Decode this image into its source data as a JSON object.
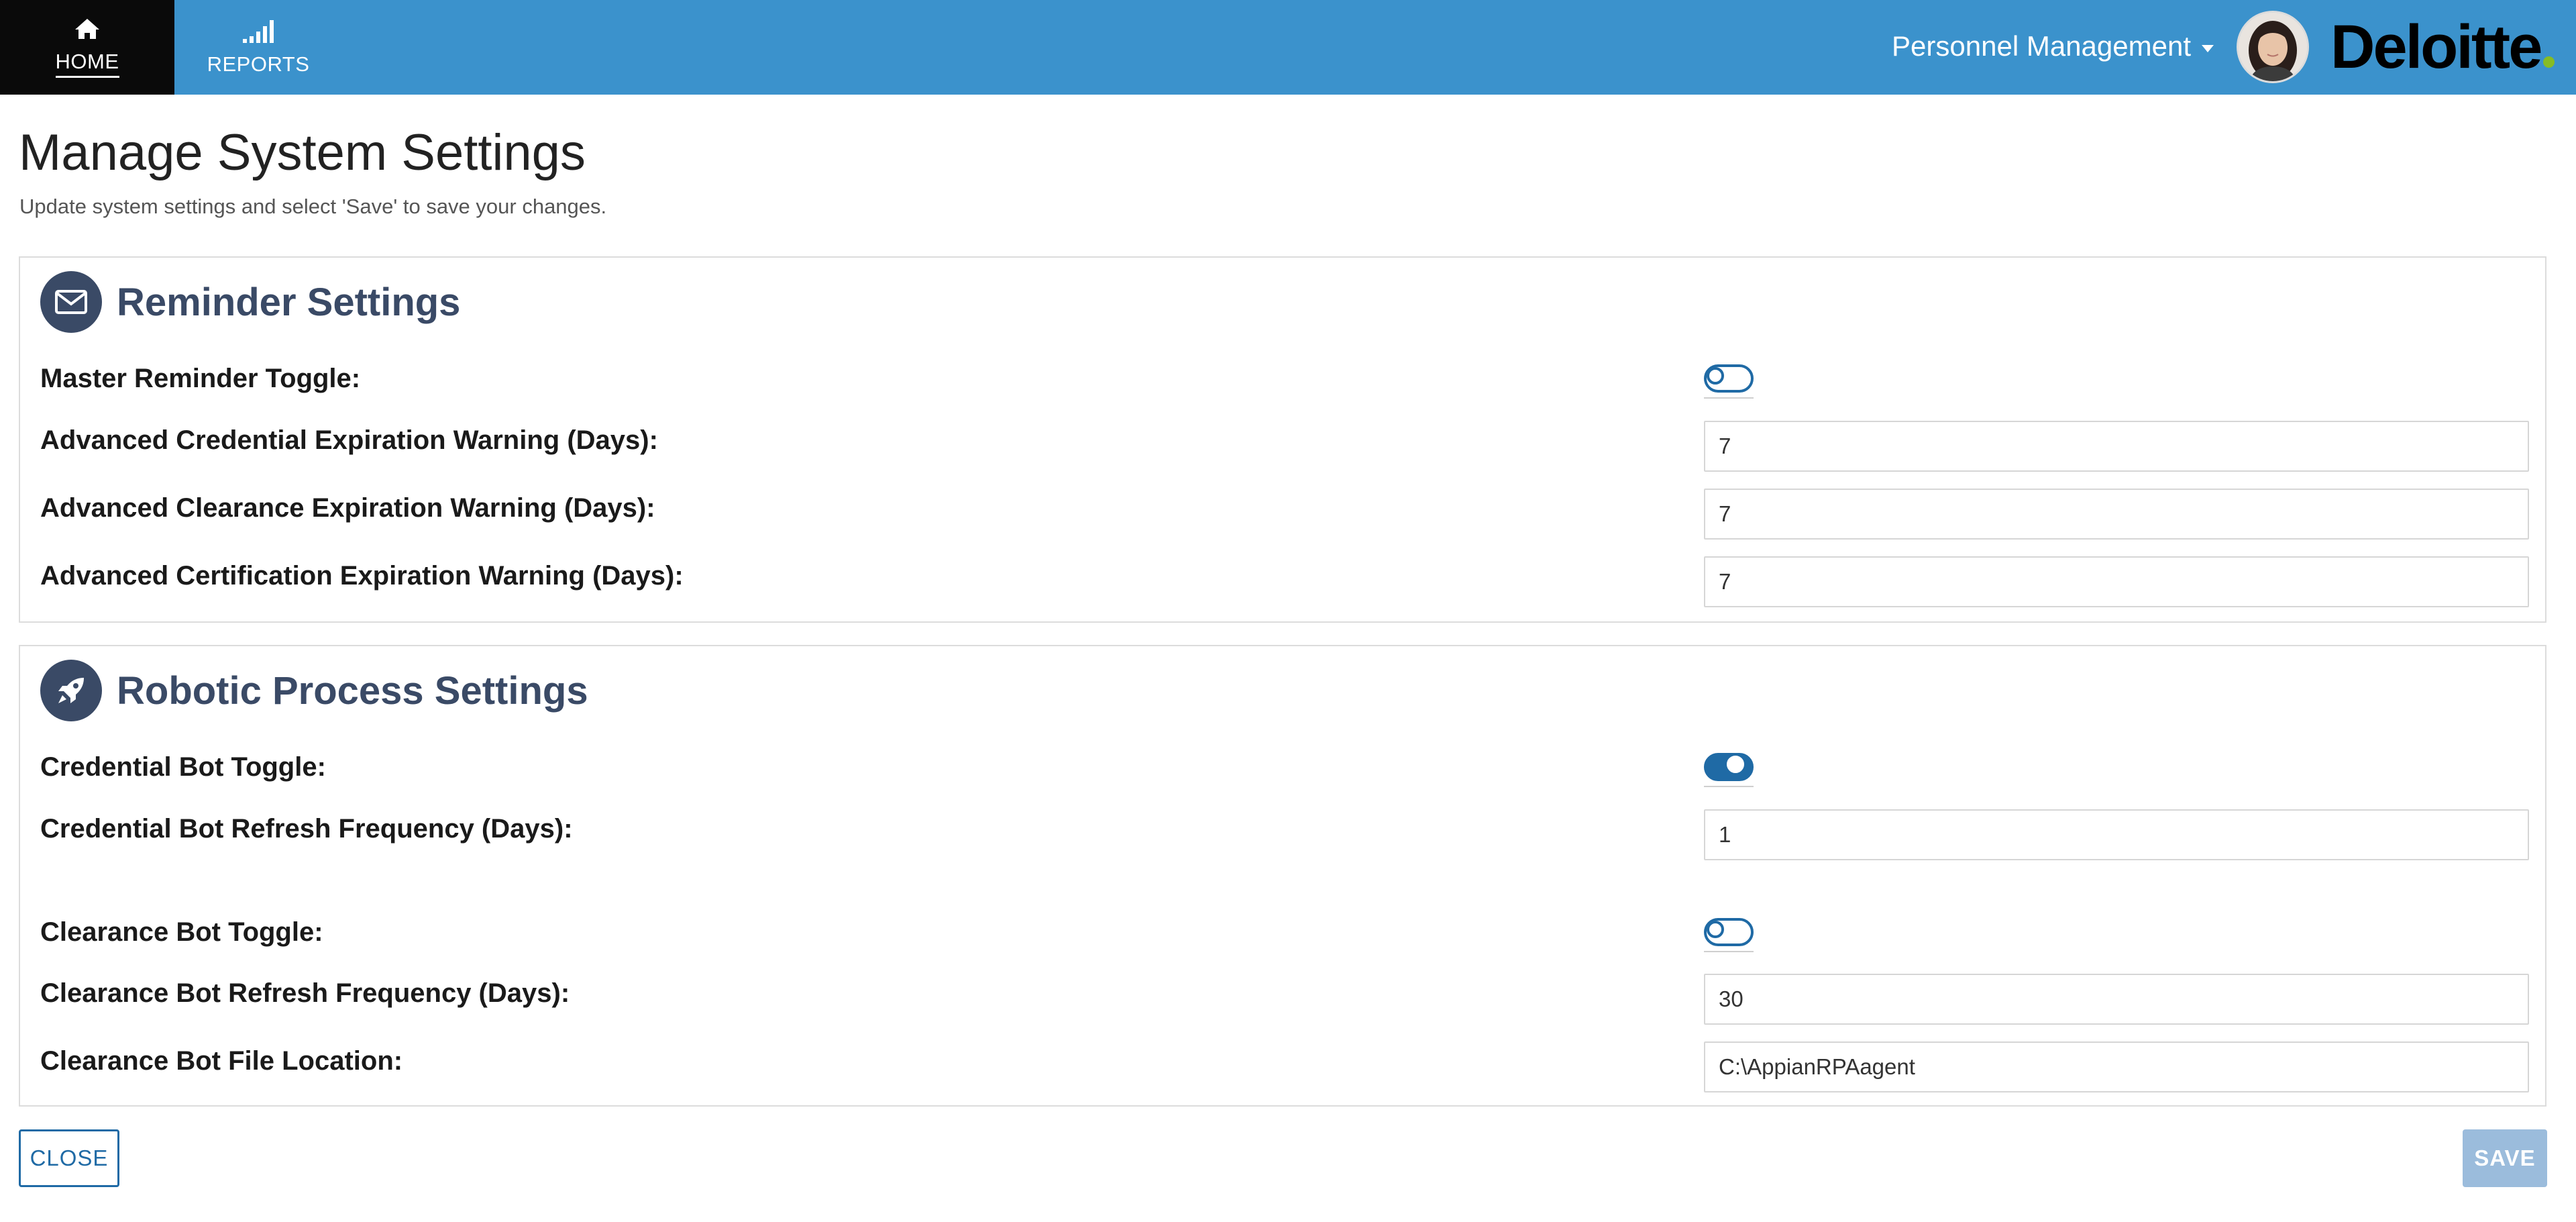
{
  "nav": {
    "home": {
      "label": "HOME",
      "icon": "home-icon"
    },
    "reports": {
      "label": "REPORTS",
      "icon": "signal-bars-icon"
    }
  },
  "app_switcher": {
    "label": "Personnel Management"
  },
  "brand": {
    "logo_text": "Deloitte",
    "dot_color": "#86bc25"
  },
  "colors": {
    "topbar": "#3b92cc",
    "active_tab": "#0a0a0a",
    "section_title": "#3a4a66",
    "toggle_accent": "#1f6aa5",
    "save_disabled": "#9bbcdc"
  },
  "page": {
    "title": "Manage System Settings",
    "subtitle": "Update system settings and select 'Save' to save your changes."
  },
  "reminder": {
    "title": "Reminder Settings",
    "icon": "envelope-icon",
    "master_toggle": {
      "label": "Master Reminder Toggle:",
      "state": "off"
    },
    "credential_warning": {
      "label": "Advanced Credential Expiration Warning (Days):",
      "value": "7"
    },
    "clearance_warning": {
      "label": "Advanced Clearance Expiration Warning (Days):",
      "value": "7"
    },
    "certification_warning": {
      "label": "Advanced Certification Expiration Warning (Days):",
      "value": "7"
    }
  },
  "robotic": {
    "title": "Robotic Process Settings",
    "icon": "rocket-icon",
    "credential_bot_toggle": {
      "label": "Credential Bot Toggle:",
      "state": "on"
    },
    "credential_bot_refresh": {
      "label": "Credential Bot Refresh Frequency (Days):",
      "value": "1"
    },
    "clearance_bot_toggle": {
      "label": "Clearance Bot Toggle:",
      "state": "off"
    },
    "clearance_bot_refresh": {
      "label": "Clearance Bot Refresh Frequency (Days):",
      "value": "30"
    },
    "clearance_bot_location": {
      "label": "Clearance Bot File Location:",
      "value": "C:\\AppianRPAagent"
    }
  },
  "footer": {
    "close_label": "CLOSE",
    "save_label": "SAVE"
  }
}
